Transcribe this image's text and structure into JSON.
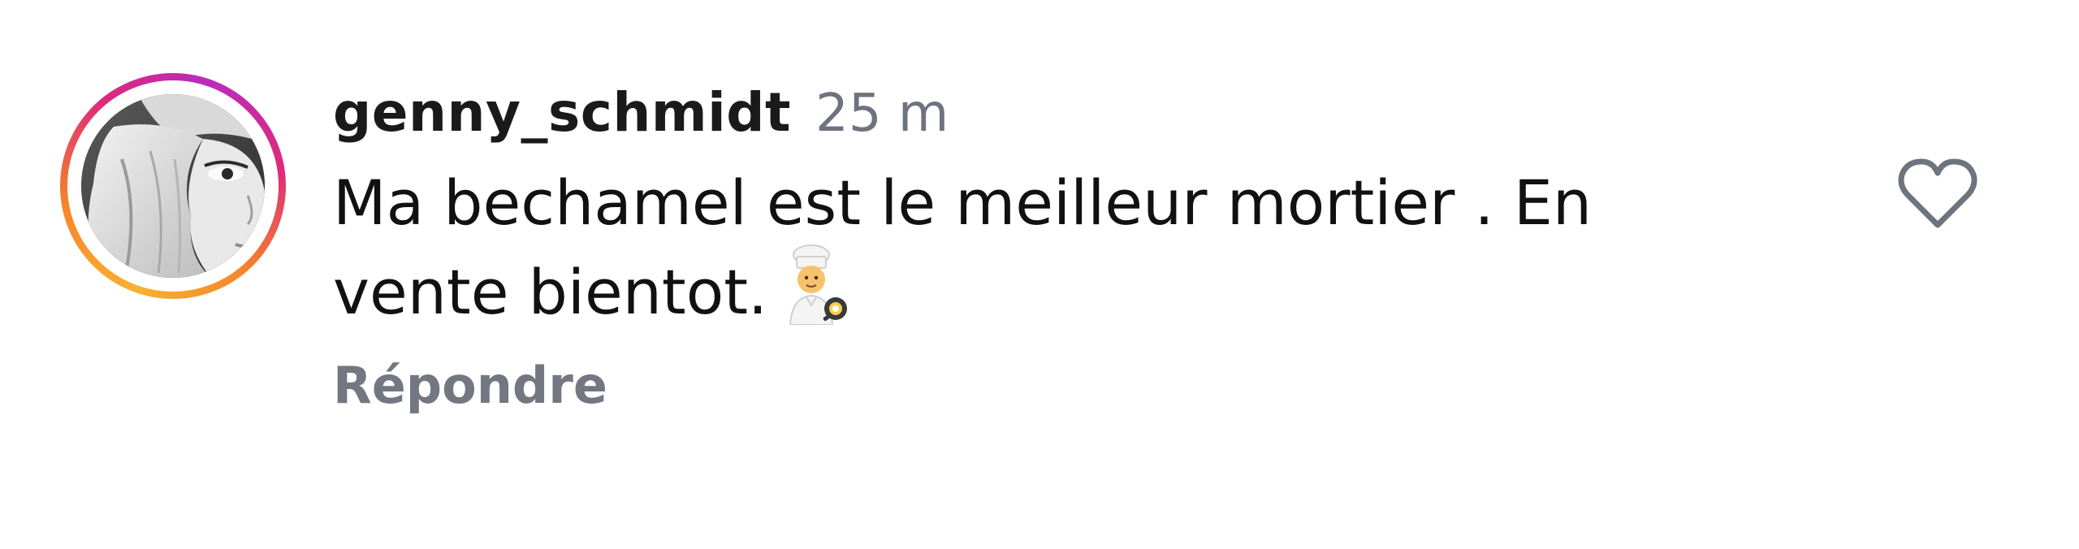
{
  "comment": {
    "username": "genny_schmidt",
    "timestamp": "25 m",
    "text": "Ma bechamel est le meilleur mortier .  En vente bientot.",
    "emoji": "cook-emoji",
    "reply_label": "Répondre",
    "like_icon": "heart-outline-icon"
  },
  "colors": {
    "username": "#1a1a1a",
    "timestamp": "#6e7380",
    "reply": "#737781",
    "heart_outline": "#6e7380",
    "ring_gradient": [
      "#f9b233",
      "#f58529",
      "#dd2a7b",
      "#b92bbf"
    ]
  }
}
